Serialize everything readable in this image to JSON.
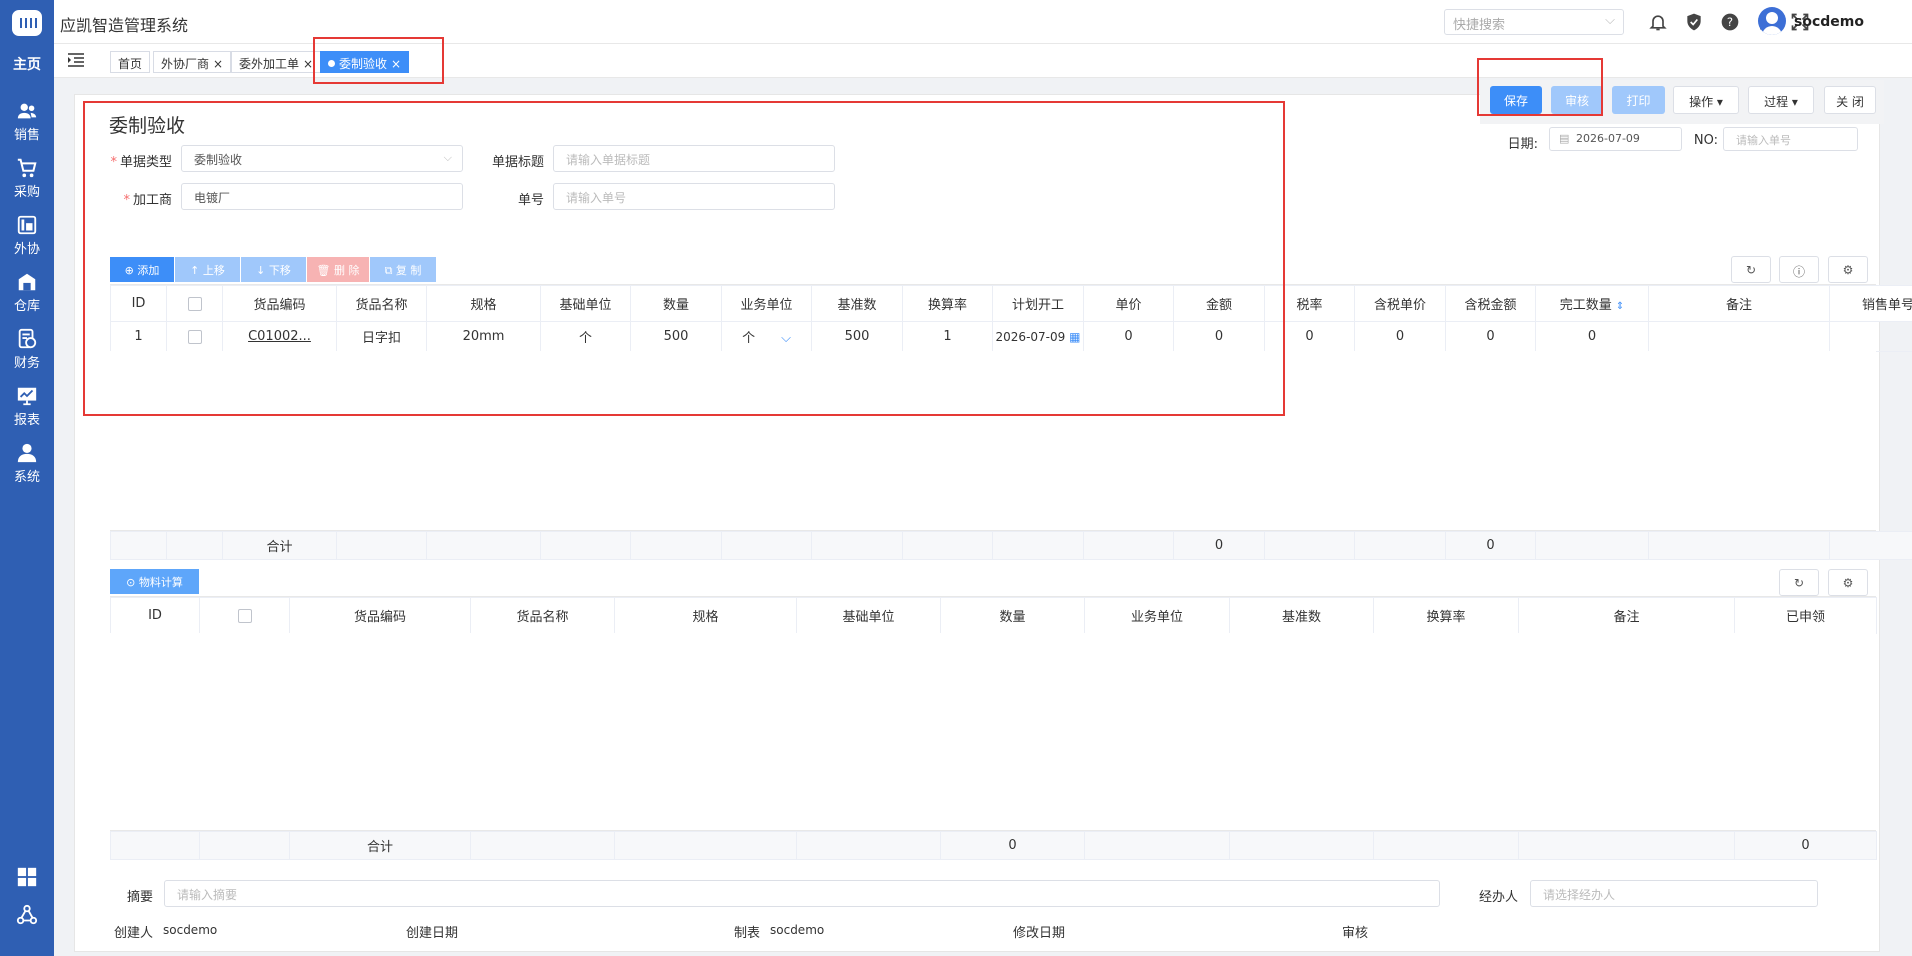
{
  "app": {
    "title": "应凯智造管理系统"
  },
  "sidebar": {
    "home": "主页",
    "items": [
      {
        "label": "销售",
        "icon": "users-icon"
      },
      {
        "label": "采购",
        "icon": "cart-icon"
      },
      {
        "label": "外协",
        "icon": "outsource-icon"
      },
      {
        "label": "仓库",
        "icon": "warehouse-icon"
      },
      {
        "label": "财务",
        "icon": "finance-icon"
      },
      {
        "label": "报表",
        "icon": "report-icon"
      },
      {
        "label": "系统",
        "icon": "person-icon"
      }
    ]
  },
  "header": {
    "search_placeholder": "快捷搜索",
    "username": "socdemo"
  },
  "tabs": [
    {
      "label": "首页"
    },
    {
      "label": "外协厂商",
      "close": "×"
    },
    {
      "label": "委外加工单",
      "close": "×"
    },
    {
      "label": "委制验收",
      "close": "×"
    }
  ],
  "actions": {
    "save": "保存",
    "audit": "审核",
    "print": "打印",
    "operate": "操作 ▾",
    "process": "过程 ▾",
    "close": "关 闭"
  },
  "form": {
    "title": "委制验收",
    "doc_type_label": "单据类型",
    "doc_type_value": "委制验收",
    "doc_title_label": "单据标题",
    "doc_title_placeholder": "请输入单据标题",
    "processor_label": "加工商",
    "processor_value": "电镀厂",
    "doc_no_label": "单号",
    "doc_no_placeholder": "请输入单号",
    "date_label": "日期:",
    "date_value": "2026-07-09",
    "no_label": "NO:",
    "no_placeholder": "请输入单号"
  },
  "toolbar": {
    "add": "⊕ 添加",
    "up": "↑ 上移",
    "down": "↓ 下移",
    "delete": "🗑 删 除",
    "copy": "⧉ 复 制",
    "refresh": "↻",
    "info": "ⓘ",
    "settings": "⚙"
  },
  "main_table": {
    "headers": [
      "ID",
      "",
      "货品编码",
      "货品名称",
      "规格",
      "基础单位",
      "数量",
      "业务单位",
      "基准数",
      "换算率",
      "计划开工",
      "单价",
      "金额",
      "税率",
      "含税单价",
      "含税金额",
      "完工数量",
      "备注",
      "销售单号"
    ],
    "row": {
      "id": "1",
      "code": "C01002...",
      "name": "日字扣",
      "spec": "20mm",
      "base_unit": "个",
      "qty": "500",
      "biz_unit": "个",
      "base_qty": "500",
      "rate": "1",
      "plan_start": "2026-07-09",
      "price": "0",
      "amount": "0",
      "tax_rate": "0",
      "tax_price": "0",
      "tax_amount": "0",
      "done_qty": "0"
    },
    "sum_label": "合计",
    "sum_amount": "0",
    "sum_tax_amount": "0"
  },
  "material": {
    "button": "⊙ 物料计算",
    "headers": [
      "ID",
      "",
      "货品编码",
      "货品名称",
      "规格",
      "基础单位",
      "数量",
      "业务单位",
      "基准数",
      "换算率",
      "备注",
      "已申领"
    ],
    "sum_label": "合计",
    "sum_qty": "0",
    "sum_claimed": "0"
  },
  "footer": {
    "summary_label": "摘要",
    "summary_placeholder": "请输入摘要",
    "handler_label": "经办人",
    "handler_placeholder": "请选择经办人",
    "creator_label": "创建人",
    "creator_value": "socdemo",
    "create_date_label": "创建日期",
    "maker_label": "制表",
    "maker_value": "socdemo",
    "modify_date_label": "修改日期",
    "audit_label": "审核"
  }
}
